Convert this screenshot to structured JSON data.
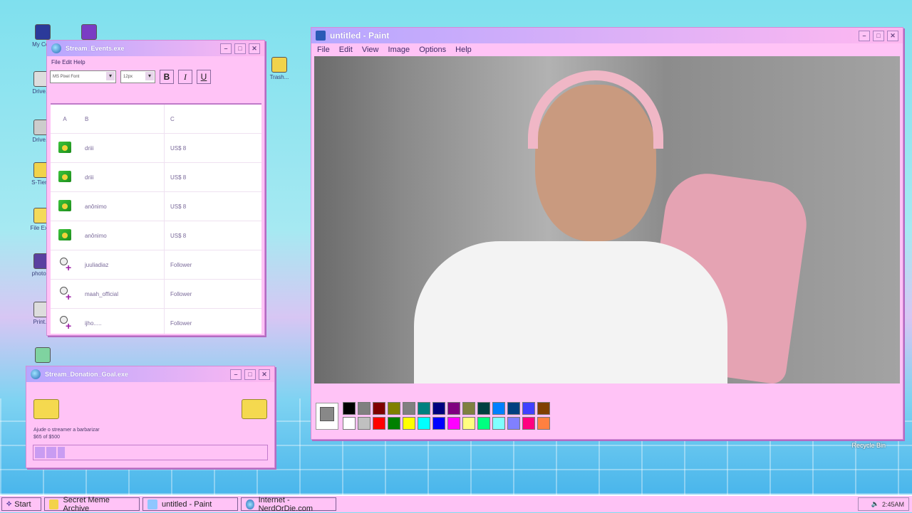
{
  "desktop": {
    "icons": [
      {
        "label": "My Co..."
      },
      {
        "label": "Drive..."
      },
      {
        "label": "Drive..."
      },
      {
        "label": "S-Tier..."
      },
      {
        "label": "File Ex..."
      },
      {
        "label": "photo..."
      },
      {
        "label": "Print..."
      },
      {
        "label": "Trash..."
      },
      {
        "label": "Recycle Bin"
      }
    ]
  },
  "events_window": {
    "title": "Stream_Events.exe",
    "menu": "File Edit Help",
    "font_select": "MS Pixel Font",
    "size_select": "12px",
    "bold": "B",
    "italic": "I",
    "underline": "U",
    "columns": [
      "A",
      "B",
      "C"
    ],
    "rows": [
      {
        "icon": "money-icon",
        "name": "driii",
        "value": "US$ 8"
      },
      {
        "icon": "money-icon",
        "name": "driii",
        "value": "US$ 8"
      },
      {
        "icon": "money-icon",
        "name": "anônimo",
        "value": "US$ 8"
      },
      {
        "icon": "money-icon",
        "name": "anônimo",
        "value": "US$ 8"
      },
      {
        "icon": "follow-icon",
        "name": "juuliadiaz",
        "value": "Follower"
      },
      {
        "icon": "follow-icon",
        "name": "maah_official",
        "value": "Follower"
      },
      {
        "icon": "follow-icon",
        "name": "ijho.....",
        "value": "Follower"
      }
    ]
  },
  "donation_window": {
    "title": "Stream_Donation_Goal.exe",
    "text_line1": "Ajude o streamer a barbarizar",
    "text_line2": "$65 of $500",
    "progress": 0.13
  },
  "paint_window": {
    "title": "untitled - Paint",
    "menu": [
      "File",
      "Edit",
      "View",
      "Image",
      "Options",
      "Help"
    ],
    "palette_top": [
      "#000000",
      "#808080",
      "#800000",
      "#808000",
      "#808080",
      "#008080",
      "#000080",
      "#800080",
      "#808040",
      "#004040",
      "#0080ff",
      "#004080",
      "#4040ff",
      "#804000"
    ],
    "palette_bottom": [
      "#ffffff",
      "#c0c0c0",
      "#ff0000",
      "#008000",
      "#ffff00",
      "#00ffff",
      "#0000ff",
      "#ff00ff",
      "#ffff80",
      "#00ff80",
      "#80ffff",
      "#8080ff",
      "#ff0080",
      "#ff8040"
    ],
    "current_color": "#888888"
  },
  "taskbar": {
    "start": "Start",
    "items": [
      {
        "label": "Secret Meme Archive"
      },
      {
        "label": "untitled - Paint"
      },
      {
        "label": "Internet - NerdOrDie.com"
      }
    ],
    "clock": "2:45AM"
  }
}
